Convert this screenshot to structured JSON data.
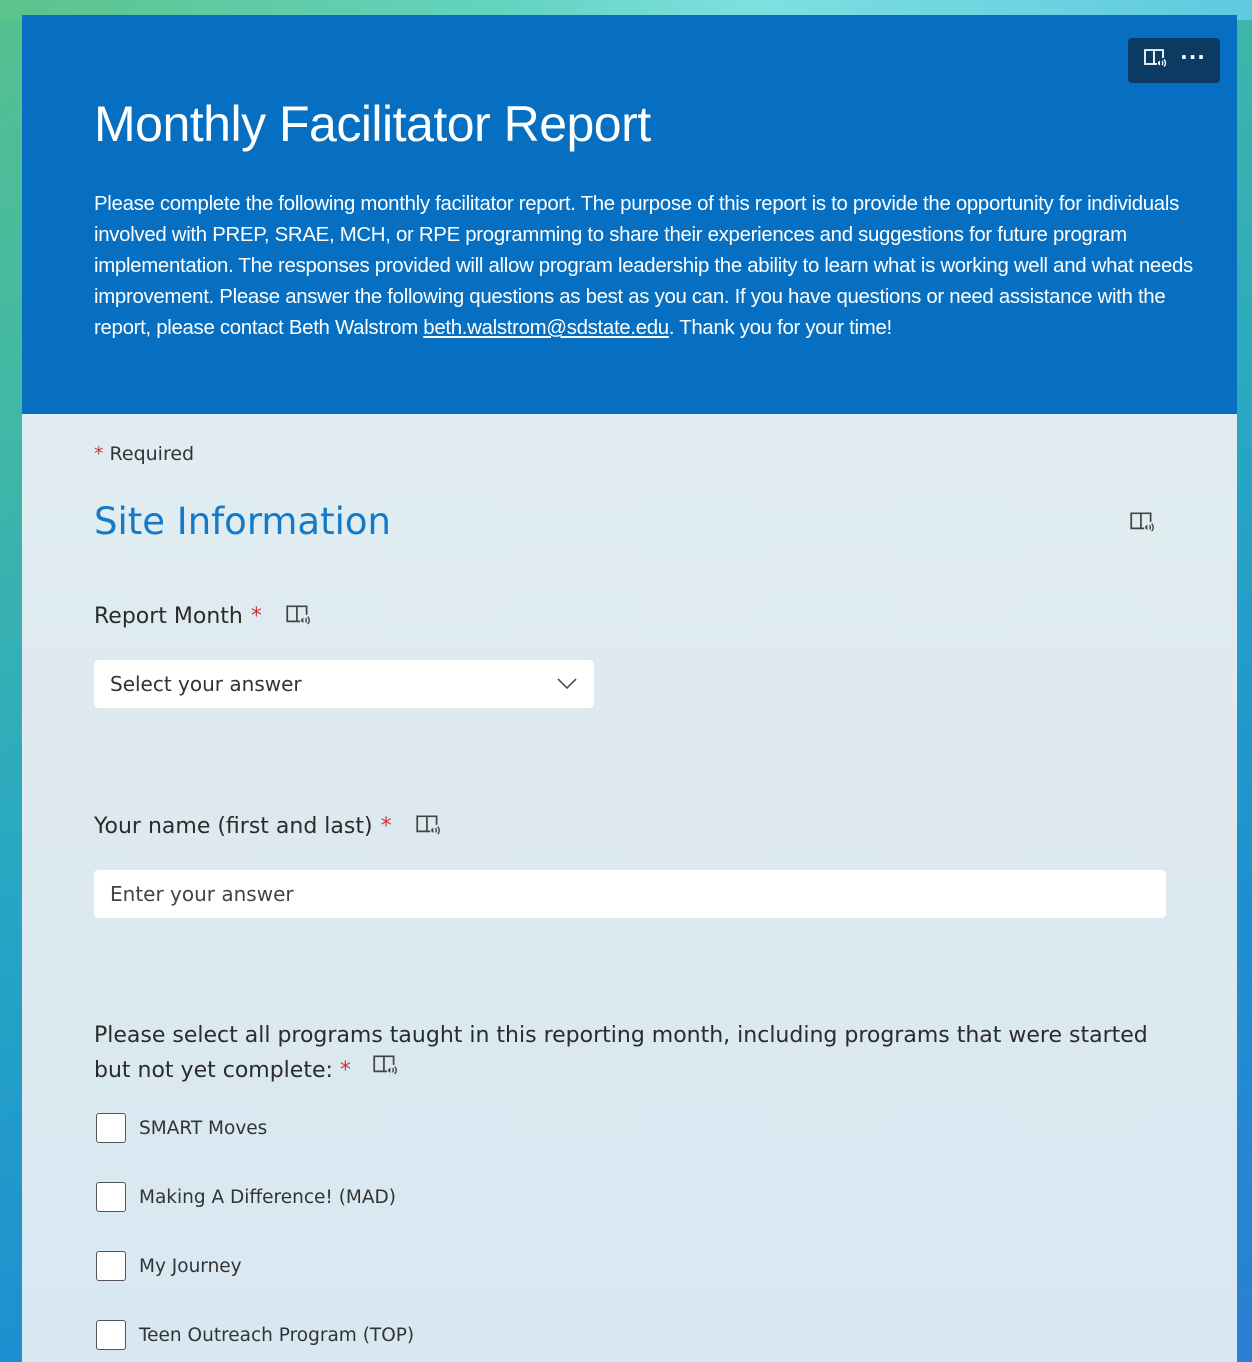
{
  "header": {
    "title": "Monthly Facilitator Report",
    "description_prefix": "Please complete the following monthly facilitator report. The purpose of this report is to provide the opportunity for individuals involved with PREP, SRAE, MCH, or RPE programming to share their experiences and suggestions for future program implementation. The responses provided will allow program leadership the ability to learn what is working well and what needs improvement. Please answer the following questions as best as you can. If you have questions or need assistance with the report, please contact Beth Walstrom ",
    "email": "beth.walstrom@sdstate.edu",
    "description_suffix": ". Thank you for your time!",
    "immersive_reader_icon": "immersive-reader-icon",
    "more_icon": "more-options-icon",
    "more_label": "···"
  },
  "form": {
    "required_star": "*",
    "required_label": "Required",
    "section_title": "Site Information",
    "q1": {
      "label": "Report Month",
      "star": "*",
      "placeholder": "Select your answer"
    },
    "q2": {
      "label": "Your name (first and last)",
      "star": "*",
      "placeholder": "Enter your answer"
    },
    "q3": {
      "label": "Please select all programs taught in this reporting month, including programs that were started but not yet complete:",
      "star": "*",
      "options": [
        "SMART Moves",
        "Making A Difference! (MAD)",
        "My Journey",
        "Teen Outreach Program (TOP)"
      ]
    }
  },
  "colors": {
    "header_bg": "#066fc1",
    "section_title": "#1479c7",
    "required_star": "#c43b3b"
  }
}
